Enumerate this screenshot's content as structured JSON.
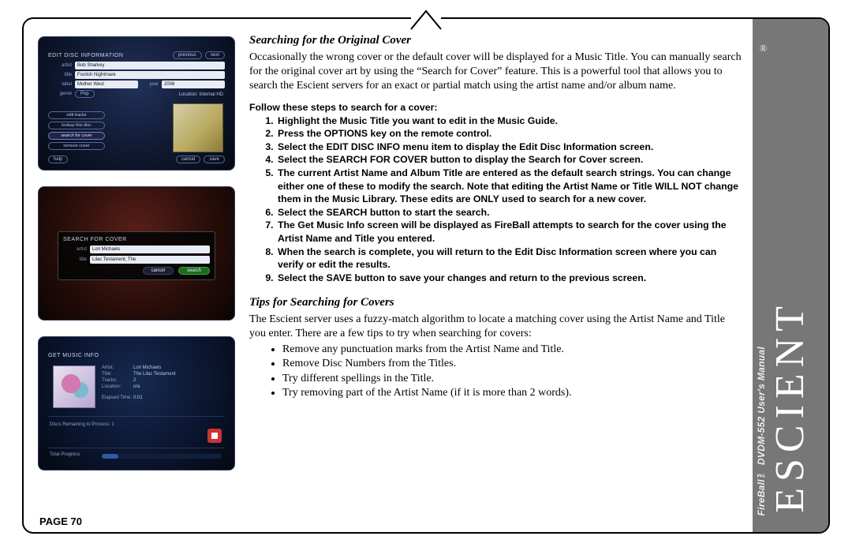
{
  "page": {
    "number": "PAGE 70",
    "brand": "ESCIENT",
    "registered": "®",
    "manual_line": "FireBall™ DVDM-552 User's Manual"
  },
  "section1": {
    "heading": "Searching for the Original Cover",
    "para": "Occasionally the wrong cover or the default cover will be displayed for a Music Title. You can manually search for the original cover art by using the “Search for Cover” feature. This is a powerful tool that allows you to search the Escient servers for an exact or partial match using the artist name and/or album name.",
    "follow": "Follow these steps to search for a cover:",
    "steps": [
      "Highlight the Music Title you want to edit in the Music Guide.",
      "Press the OPTIONS key on the remote control.",
      "Select the EDIT DISC INFO menu item to display the Edit Disc Information screen.",
      "Select the SEARCH FOR COVER button to display the Search for Cover screen.",
      "The current Artist Name and Album Title are entered as the default search strings. You can change either one of these to modify the search. Note that editing the Artist Name or Title WILL NOT change them in the Music Library. These edits are ONLY used to search for a new cover.",
      "Select the SEARCH button to start the search.",
      "The Get Music Info screen will be displayed as FireBall attempts to search for the cover using the Artist Name and Title you entered.",
      "When the search is complete, you will return to the Edit Disc Information screen where you can verify or edit the results.",
      "Select the SAVE button to save your changes and return to the previous screen."
    ]
  },
  "section2": {
    "heading": "Tips for Searching for Covers",
    "para": "The Escient server uses a fuzzy-match algorithm to locate a matching cover using the Artist Name and Title you enter. There are a few tips to try when searching for covers:",
    "tips": [
      "Remove any punctuation marks from the Artist Name and Title.",
      "Remove Disc Numbers from the Titles.",
      "Try different spellings in the Title.",
      "Try removing part of the Artist Name (if it is more than 2 words)."
    ]
  },
  "shot1": {
    "title": "EDIT DISC INFORMATION",
    "prev": "previous",
    "next": "next",
    "labels": {
      "artist": "artist",
      "title": "title",
      "label": "label",
      "year": "year",
      "genre": "genre"
    },
    "artist": "Bob Sharkey",
    "titlev": "Foolish Nightmare",
    "labelv": "Mother West",
    "yearv": "2006",
    "genrev": "Pop",
    "location_label": "Location: Internal HD",
    "buttons": {
      "edit_tracks": "edit tracks",
      "lookup": "lookup this disc",
      "search": "search for cover",
      "remove": "remove cover"
    },
    "bottom": {
      "help": "help",
      "cancel": "cancel",
      "save": "save"
    }
  },
  "shot2": {
    "title": "SEARCH FOR COVER",
    "labels": {
      "artist": "artist",
      "title": "title"
    },
    "artist": "Lori Michaels",
    "titlev": "Lilac Testament, The",
    "cancel": "cancel",
    "search": "search"
  },
  "shot3": {
    "title": "GET MUSIC INFO",
    "keys": {
      "artist": "Artist:",
      "title": "Title:",
      "tracks": "Tracks:",
      "location": "Location:",
      "elapsed": "Elapsed Time:"
    },
    "artist": "Lori Michaels",
    "album": "The Lilac Testament",
    "tracks": "2",
    "location": "n/a",
    "elapsed": "0:01",
    "remaining_label": "Discs Remaining to Process:",
    "remaining": "1",
    "total_label": "Total Progress"
  }
}
